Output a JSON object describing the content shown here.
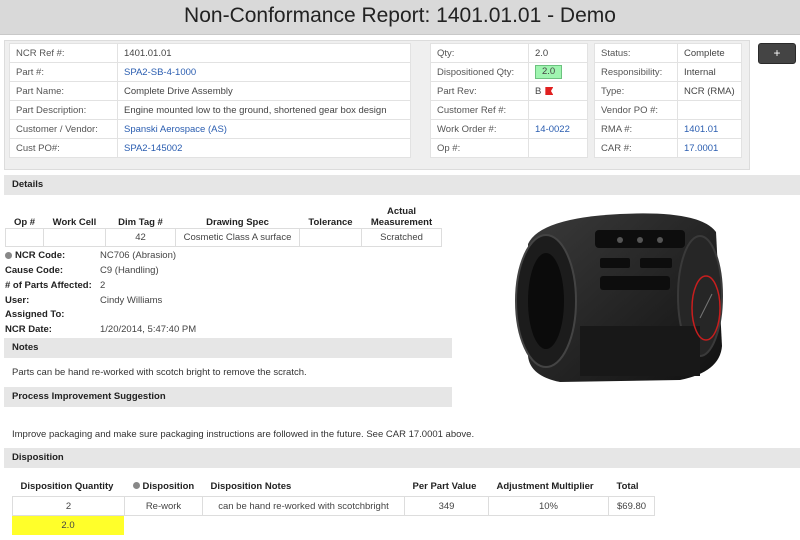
{
  "title": "Non-Conformance Report: 1401.01.01 - Demo",
  "add_button_label": "+",
  "info": {
    "col1": [
      {
        "label": "NCR Ref #:",
        "value": "1401.01.01",
        "link": false
      },
      {
        "label": "Part #:",
        "value": "SPA2-SB-4-1000",
        "link": true
      },
      {
        "label": "Part Name:",
        "value": "Complete Drive Assembly",
        "link": false
      },
      {
        "label": "Part Description:",
        "value": "Engine mounted low to the ground, shortened gear box design",
        "link": false
      },
      {
        "label": "Customer / Vendor:",
        "value": "Spanski Aerospace (AS)",
        "link": true
      },
      {
        "label": "Cust PO#:",
        "value": "SPA2-145002",
        "link": true
      }
    ],
    "col2": [
      {
        "label": "Qty:",
        "value": "2.0"
      },
      {
        "label": "Dispositioned Qty:",
        "value": "2.0"
      },
      {
        "label": "Part Rev:",
        "value": "B"
      },
      {
        "label": "Customer Ref #:",
        "value": ""
      },
      {
        "label": "Work Order #:",
        "value": "14-0022"
      },
      {
        "label": "Op #:",
        "value": ""
      }
    ],
    "col3": [
      {
        "label": "Status:",
        "value": "Complete"
      },
      {
        "label": "Responsibility:",
        "value": "Internal"
      },
      {
        "label": "Type:",
        "value": "NCR (RMA)"
      },
      {
        "label": "Vendor PO #:",
        "value": ""
      },
      {
        "label": "RMA #:",
        "value": "1401.01"
      },
      {
        "label": "CAR #:",
        "value": "17.0001"
      }
    ]
  },
  "details": {
    "title": "Details",
    "headers": [
      "Op #",
      "Work Cell",
      "Dim Tag #",
      "Drawing Spec",
      "Tolerance",
      "Actual Measurement"
    ],
    "row": [
      "",
      "",
      "42",
      "Cosmetic Class A surface",
      "",
      "Scratched"
    ],
    "fields": [
      {
        "label": "NCR Code:",
        "value": "NC706 (Abrasion)"
      },
      {
        "label": "Cause Code:",
        "value": "C9 (Handling)"
      },
      {
        "label": "# of Parts Affected:",
        "value": "2"
      },
      {
        "label": "User:",
        "value": "Cindy Williams"
      },
      {
        "label": "Assigned To:",
        "value": ""
      },
      {
        "label": "NCR Date:",
        "value": "1/20/2014, 5:47:40 PM"
      }
    ]
  },
  "notes": {
    "title": "Notes",
    "text": "Parts can be hand re-worked with scotch bright to remove the scratch."
  },
  "improvement": {
    "title": "Process Improvement Suggestion",
    "text": "Improve packaging and make sure packaging instructions are followed in the future. See CAR 17.0001 above."
  },
  "disposition": {
    "title": "Disposition",
    "headers": [
      "Disposition Quantity",
      "Disposition",
      "Disposition Notes",
      "Per Part Value",
      "Adjustment Multiplier",
      "Total"
    ],
    "row": [
      "2",
      "Re-work",
      "can be hand re-worked with scotchbright",
      "349",
      "10%",
      "$69.80"
    ],
    "total_qty": "2.0"
  },
  "colors": {
    "title_bar": "#d9d9d9",
    "section_bar": "#e6e6e6",
    "link": "#2a5db0",
    "qty_highlight": "#9ff5b0",
    "total_highlight": "#ffff2a",
    "flag": "#e02020",
    "scratch_marker": "#c81e1e"
  },
  "icons": [
    "flag-icon",
    "info-icon",
    "plus-icon"
  ]
}
